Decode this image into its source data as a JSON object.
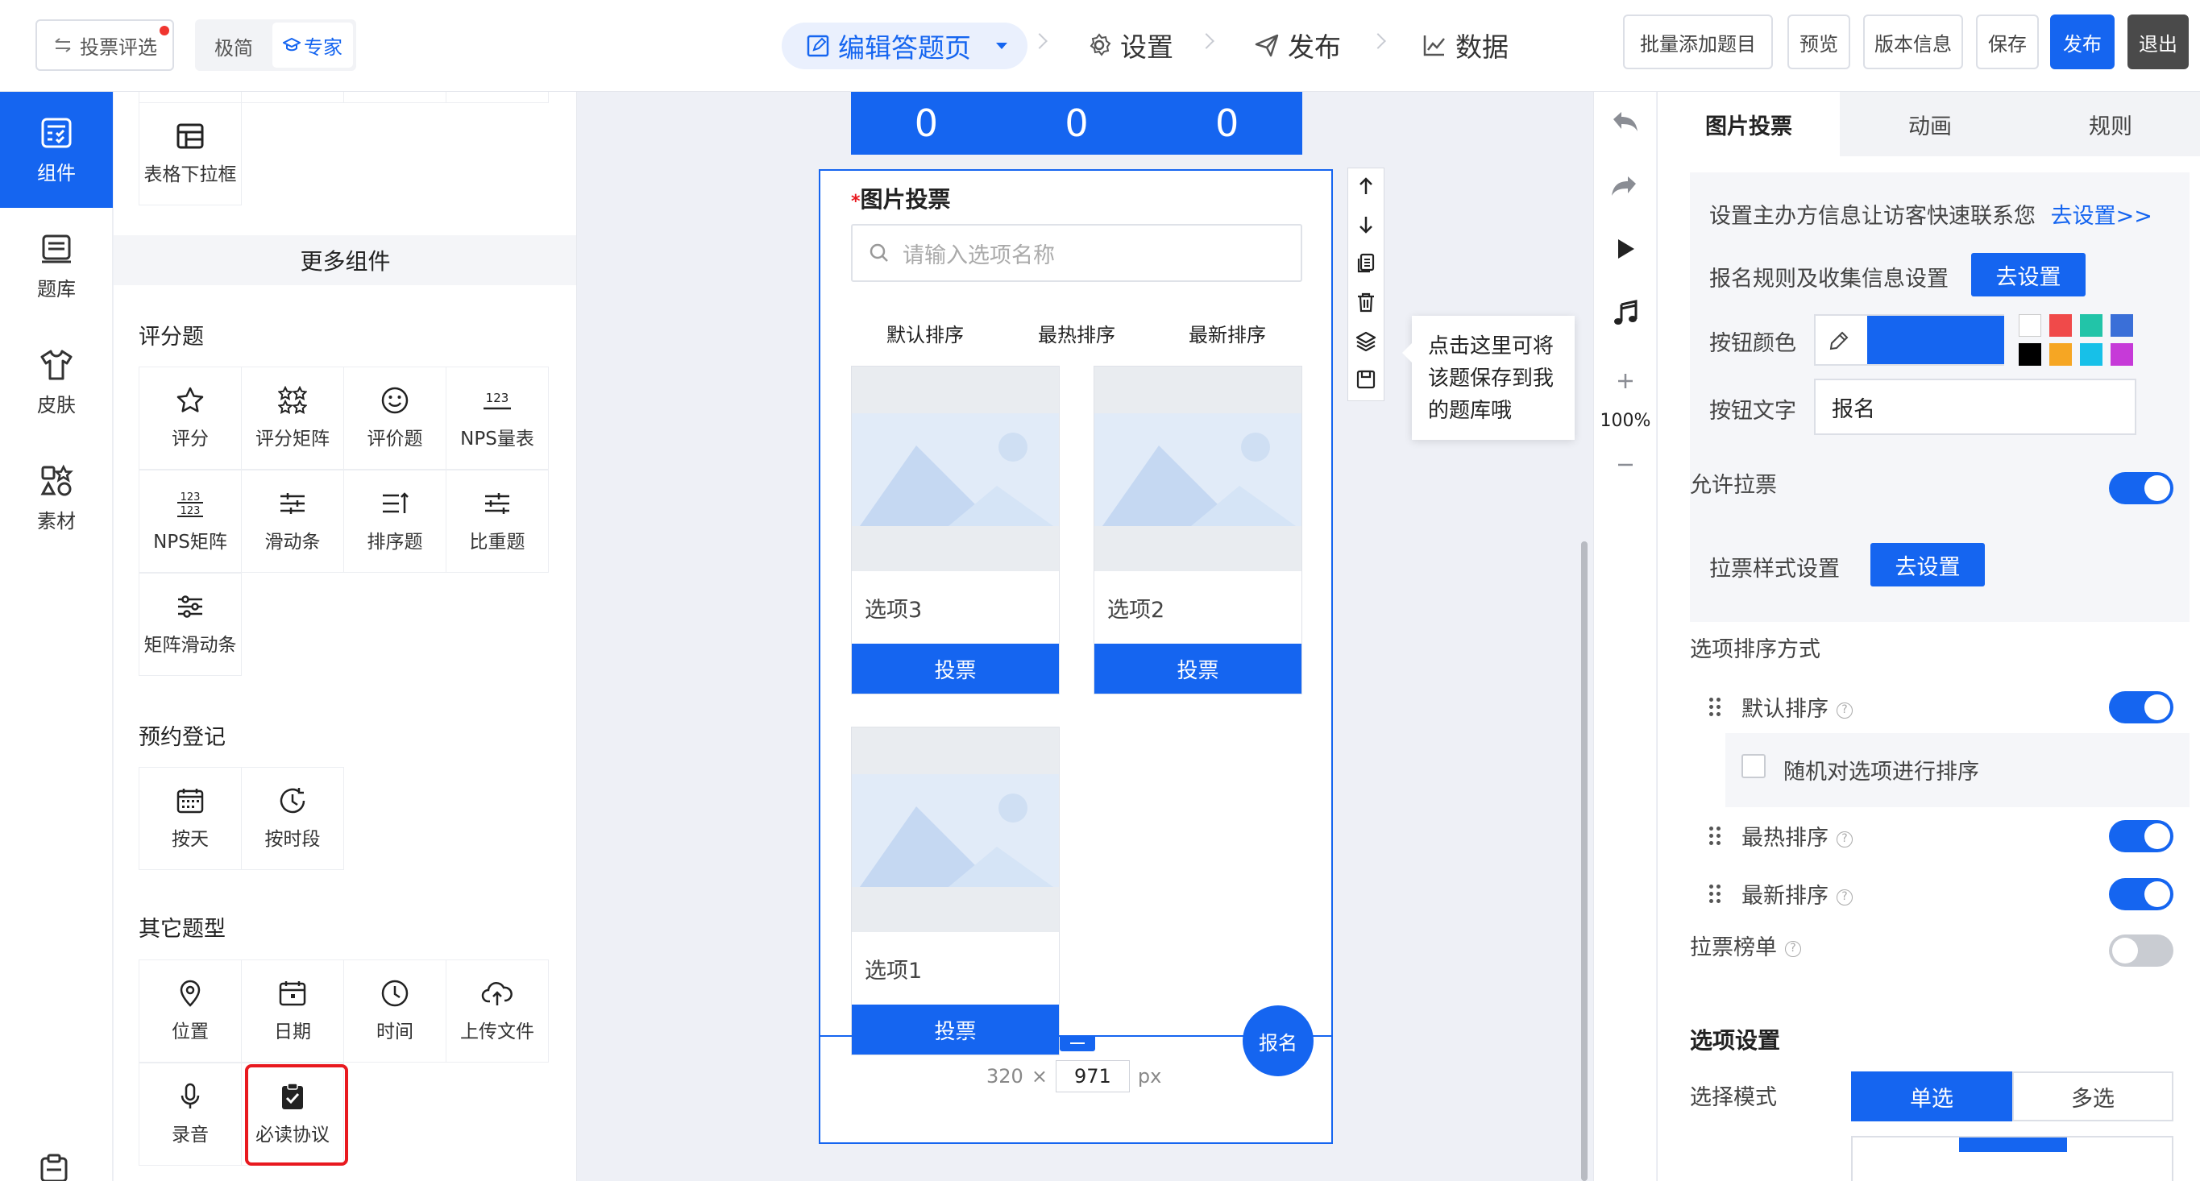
{
  "header": {
    "back_label": "投票评选",
    "mode_simple": "极简",
    "mode_expert": "专家",
    "steps": [
      "编辑答题页",
      "设置",
      "发布",
      "数据"
    ],
    "buttons": {
      "batch_add": "批量添加题目",
      "preview": "预览",
      "version": "版本信息",
      "save": "保存",
      "publish": "发布",
      "exit": "退出"
    }
  },
  "leftnav": [
    {
      "label": "组件",
      "icon": "component-icon",
      "active": true
    },
    {
      "label": "题库",
      "icon": "question-bank-icon",
      "active": false
    },
    {
      "label": "皮肤",
      "icon": "skin-shirt-icon",
      "active": false
    },
    {
      "label": "素材",
      "icon": "material-icon",
      "active": false
    }
  ],
  "components": {
    "table_dropdown": "表格下拉框",
    "more_title": "更多组件",
    "rating": {
      "title": "评分题",
      "items": [
        "评分",
        "评分矩阵",
        "评价题",
        "NPS量表",
        "NPS矩阵",
        "滑动条",
        "排序题",
        "比重题",
        "矩阵滑动条"
      ]
    },
    "booking": {
      "title": "预约登记",
      "items": [
        "按天",
        "按时段"
      ]
    },
    "other": {
      "title": "其它题型",
      "items": [
        "位置",
        "日期",
        "时间",
        "上传文件",
        "录音",
        "必读协议"
      ]
    }
  },
  "preview": {
    "counters": [
      "0",
      "0",
      "0"
    ],
    "question_title": "图片投票",
    "required_mark": "*",
    "search_placeholder": "请输入选项名称",
    "sort_tabs": [
      "默认排序",
      "最热排序",
      "最新排序"
    ],
    "options": [
      {
        "name": "选项3",
        "vote": "投票"
      },
      {
        "name": "选项2",
        "vote": "投票"
      },
      {
        "name": "选项1",
        "vote": "投票"
      }
    ],
    "signup_fab": "报名",
    "size": {
      "width": "320",
      "times": "×",
      "height": "971",
      "unit": "px"
    },
    "tooltip": "点击这里可将该题保存到我的题库哦"
  },
  "zoom": "100%",
  "settings": {
    "tabs": [
      "图片投票",
      "动画",
      "规则"
    ],
    "organizer_text": "设置主办方信息让访客快速联系您",
    "organizer_link": "去设置>>",
    "signup_rules_label": "报名规则及收集信息设置",
    "go_set": "去设置",
    "button_color_label": "按钮颜色",
    "button_color": "#1565f0",
    "swatches": [
      "#ffffff",
      "#f04a4a",
      "#22c4a8",
      "#3a6fd8",
      "#000000",
      "#f6a623",
      "#17c0e8",
      "#c63ad8"
    ],
    "button_text_label": "按钮文字",
    "button_text_value": "报名",
    "allow_canvass": "允许拉票",
    "canvass_style": "拉票样式设置",
    "canvass_style_btn": "去设置",
    "sort_mode_title": "选项排序方式",
    "sort_default": "默认排序",
    "sort_random": "随机对选项进行排序",
    "sort_hot": "最热排序",
    "sort_new": "最新排序",
    "canvass_rank": "拉票榜单",
    "option_settings": "选项设置",
    "select_mode_label": "选择模式",
    "select_single": "单选",
    "select_multi": "多选"
  }
}
